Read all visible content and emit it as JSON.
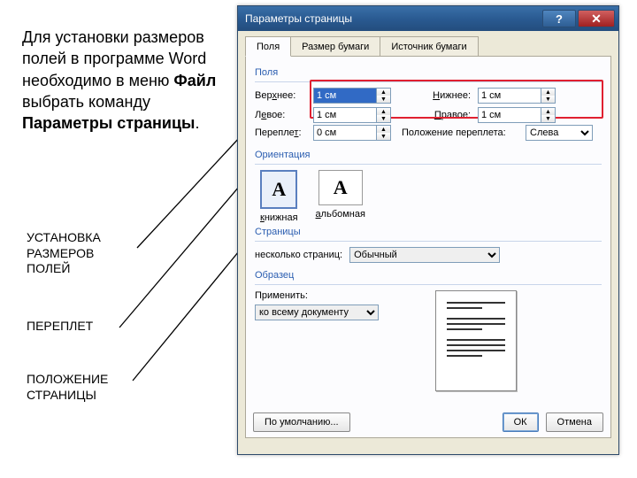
{
  "slideText": {
    "part1": "Для установки размеров полей в программе Word необходимо в меню ",
    "bold1": "Файл",
    "part2": " выбрать команду ",
    "bold2": "Параметры страницы",
    "part3": "."
  },
  "labels": {
    "margins": "УСТАНОВКА РАЗМЕРОВ ПОЛЕЙ",
    "gutter": "ПЕРЕПЛЕТ",
    "orientation": "ПОЛОЖЕНИЕ СТРАНИЦЫ"
  },
  "dialog": {
    "title": "Параметры страницы",
    "tabs": {
      "fields": "Поля",
      "paper": "Размер бумаги",
      "source": "Источник бумаги"
    },
    "groups": {
      "fields": "Поля",
      "orientation": "Ориентация",
      "pages": "Страницы",
      "sample": "Образец"
    },
    "fieldLabels": {
      "top": "Верхнее:",
      "bottom": "Нижнее:",
      "left": "Левое:",
      "right": "Правое:",
      "gutter": "Переплет:",
      "gutterPos": "Положение переплета:"
    },
    "values": {
      "top": "1 см",
      "bottom": "1 см",
      "left": "1 см",
      "right": "1 см",
      "gutter": "0 см",
      "gutterPos": "Слева"
    },
    "orientation": {
      "portrait": "книжная",
      "landscape": "альбомная"
    },
    "pages": {
      "label": "несколько страниц:",
      "value": "Обычный"
    },
    "apply": {
      "label": "Применить:",
      "value": "ко всему документу"
    },
    "buttons": {
      "default": "По умолчанию...",
      "ok": "ОК",
      "cancel": "Отмена"
    }
  },
  "underlineChars": {
    "top": "х",
    "bottom": "Н",
    "left": "е",
    "right": "П",
    "gutter": "т",
    "portrait": "к",
    "landscape": "а"
  }
}
